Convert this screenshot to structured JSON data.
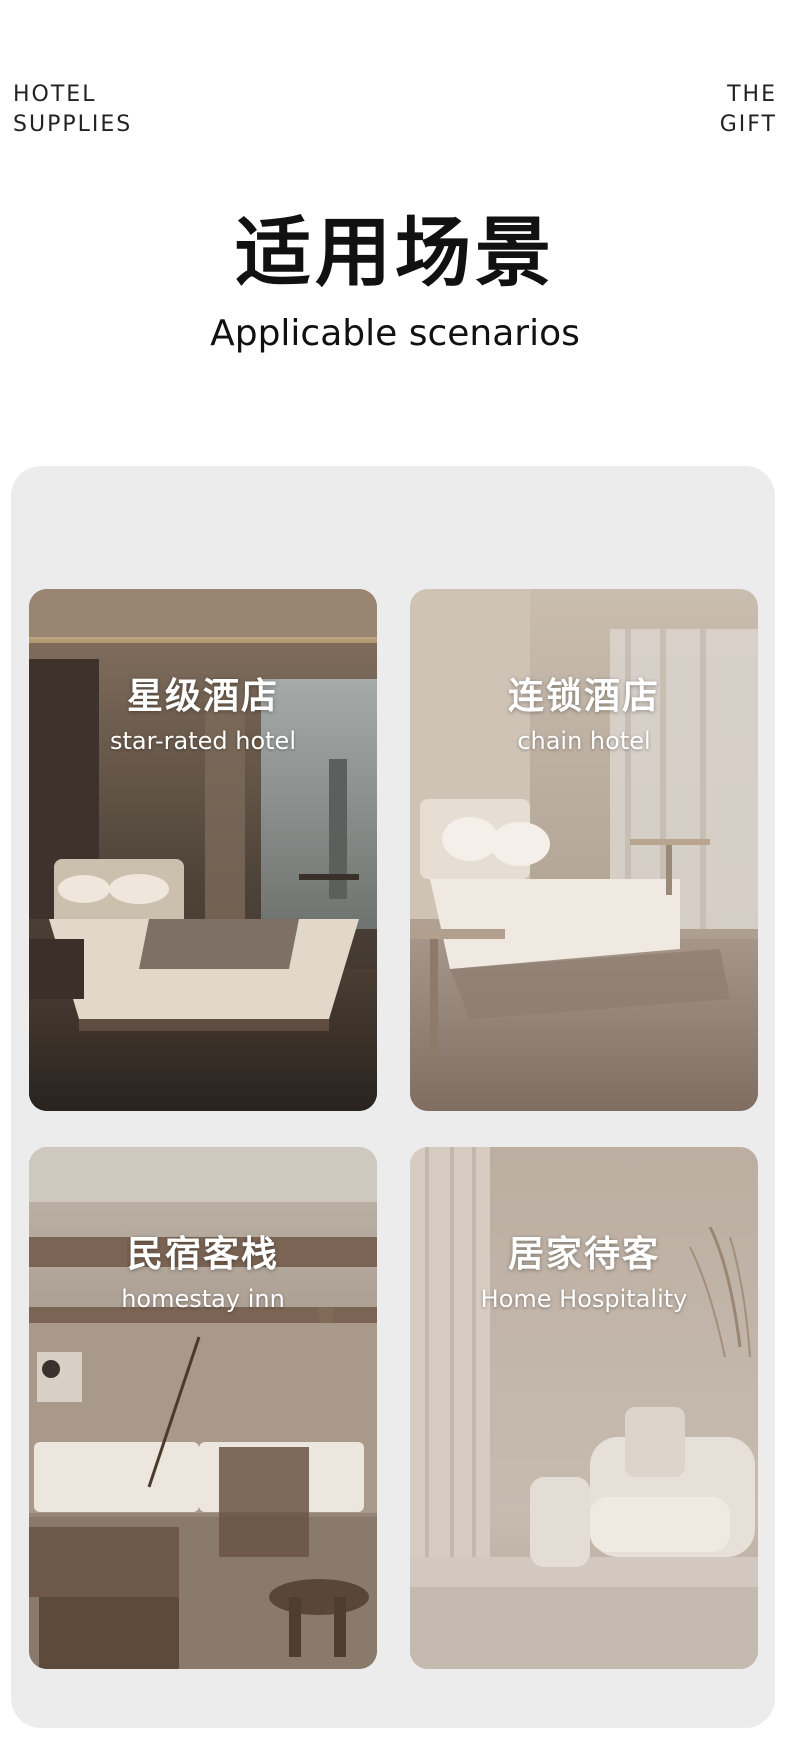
{
  "brand": {
    "left_line1": "HOTEL",
    "left_line2": "SUPPLIES",
    "right_line1": "THE",
    "right_line2": "GIFT"
  },
  "hero": {
    "title": "适用场景",
    "subtitle": "Applicable scenarios"
  },
  "scenarios": [
    {
      "title_cn": "星级酒店",
      "title_en": "star-rated hotel"
    },
    {
      "title_cn": "连锁酒店",
      "title_en": "chain hotel"
    },
    {
      "title_cn": "民宿客栈",
      "title_en": "homestay inn"
    },
    {
      "title_cn": "居家待客",
      "title_en": "Home Hospitality"
    }
  ]
}
